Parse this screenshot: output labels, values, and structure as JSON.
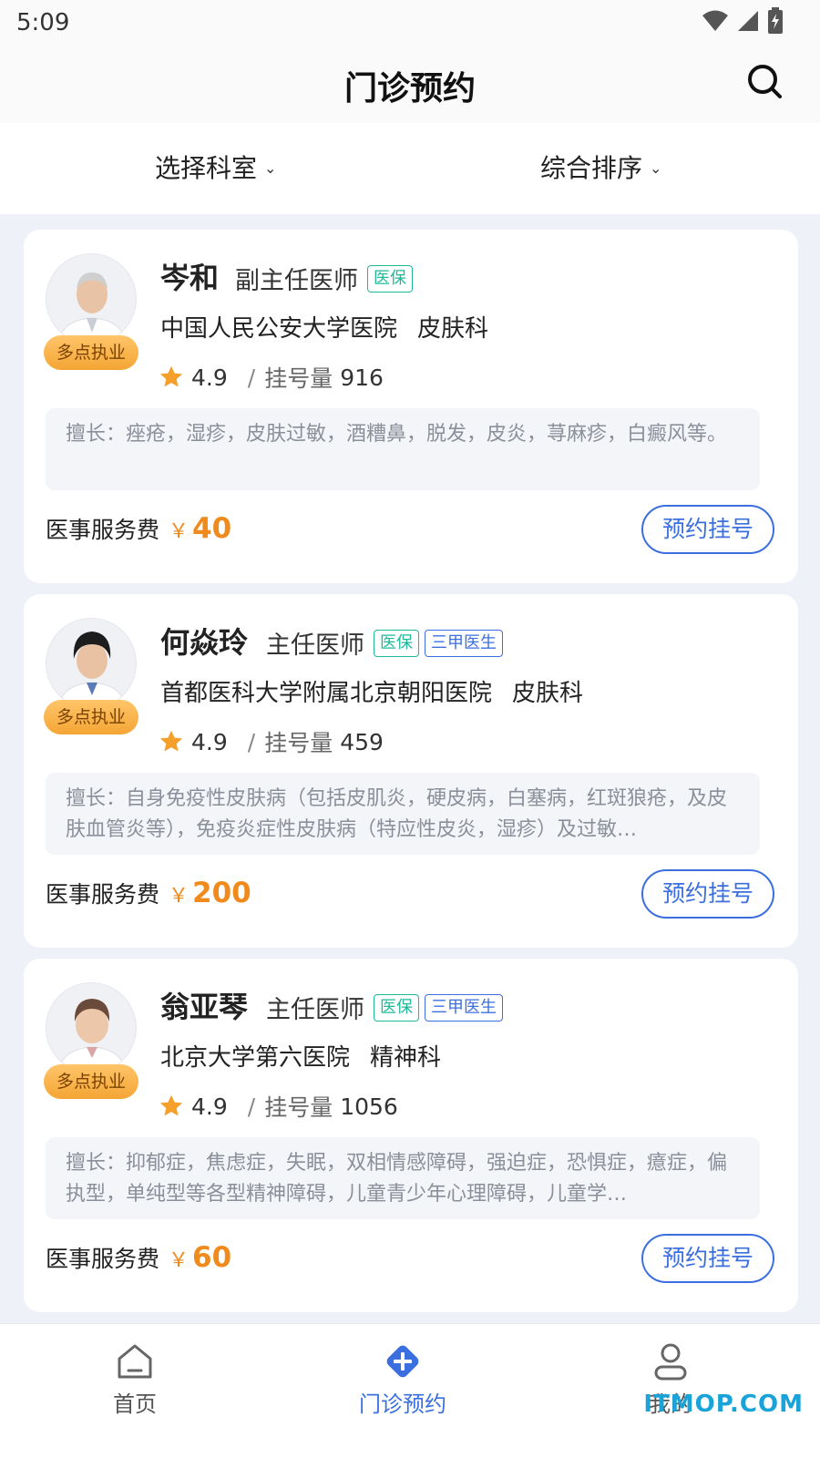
{
  "status_bar": {
    "time": "5:09"
  },
  "header": {
    "title": "门诊预约"
  },
  "filters": {
    "department": "选择科室",
    "sort": "综合排序"
  },
  "colors": {
    "accent": "#3b6fe0",
    "price": "#f08a1c",
    "insurance_tag": "#1fb99a",
    "badge": "#f4a534"
  },
  "common": {
    "multi_practice": "多点执业",
    "rating_sep": "/",
    "reg_label": "挂号量",
    "fee_label": "医事服务费",
    "currency": "￥",
    "book_button": "预约挂号",
    "tag_insurance": "医保",
    "tag_top_hospital": "三甲医生"
  },
  "doctors": [
    {
      "name": "岑和",
      "title": "副主任医师",
      "tags": [
        "医保"
      ],
      "hospital": "中国人民公安大学医院",
      "department": "皮肤科",
      "rating": "4.9",
      "registrations": "916",
      "specialty": "擅长：痤疮，湿疹，皮肤过敏，酒糟鼻，脱发，皮炎，荨麻疹，白癜风等。",
      "fee": "40"
    },
    {
      "name": "何焱玲",
      "title": "主任医师",
      "tags": [
        "医保",
        "三甲医生"
      ],
      "hospital": "首都医科大学附属北京朝阳医院",
      "department": "皮肤科",
      "rating": "4.9",
      "registrations": "459",
      "specialty": "擅长：自身免疫性皮肤病（包括皮肌炎，硬皮病，白塞病，红斑狼疮，及皮肤血管炎等），免疫炎症性皮肤病（特应性皮炎，湿疹）及过敏…",
      "fee": "200"
    },
    {
      "name": "翁亚琴",
      "title": "主任医师",
      "tags": [
        "医保",
        "三甲医生"
      ],
      "hospital": "北京大学第六医院",
      "department": "精神科",
      "rating": "4.9",
      "registrations": "1056",
      "specialty": "擅长：抑郁症，焦虑症，失眠，双相情感障碍，强迫症，恐惧症，癔症，偏执型，单纯型等各型精神障碍，儿童青少年心理障碍，儿童学…",
      "fee": "60"
    }
  ],
  "bottom_nav": {
    "items": [
      {
        "label": "首页",
        "icon": "home-icon"
      },
      {
        "label": "门诊预约",
        "icon": "clinic-plus-icon"
      },
      {
        "label": "我的",
        "icon": "user-icon"
      }
    ]
  },
  "watermark": "ITMOP.COM"
}
